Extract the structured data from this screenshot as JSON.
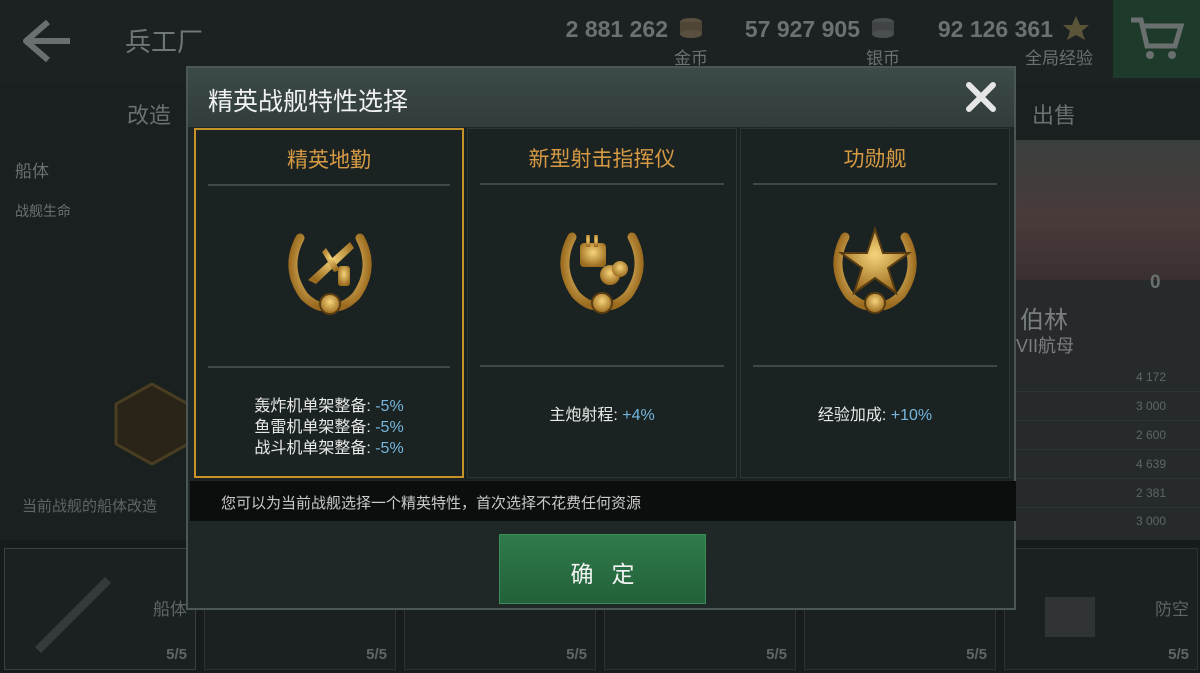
{
  "header": {
    "page_title": "兵工厂",
    "resources": [
      {
        "value": "2 881 262",
        "label": "金币",
        "icon": "gold-coins-icon"
      },
      {
        "value": "57 927 905",
        "label": "银币",
        "icon": "silver-coins-icon"
      },
      {
        "value": "92 126 361",
        "label": "全局经验",
        "icon": "star-icon"
      }
    ]
  },
  "tabs": {
    "left": "改造",
    "right": "出售"
  },
  "left_panel": {
    "title": "船体",
    "subtitle": "战舰生命",
    "note": "当前战舰的船体改造"
  },
  "right_panel": {
    "count": "0",
    "ship_name": "伯林",
    "ship_type": "VII航母",
    "numbers": [
      "4 172",
      "3 000",
      "2 600",
      "4 639",
      "2 381",
      "3 000"
    ]
  },
  "bottom_slots": [
    {
      "name": "船体",
      "count": "5/5"
    },
    {
      "name": "",
      "count": "5/5"
    },
    {
      "name": "",
      "count": "5/5"
    },
    {
      "name": "",
      "count": "5/5"
    },
    {
      "name": "",
      "count": "5/5"
    },
    {
      "name": "防空",
      "count": "5/5"
    }
  ],
  "modal": {
    "title": "精英战舰特性选择",
    "cards": [
      {
        "title": "精英地勤",
        "selected": true,
        "icon": "aircraft-laurel-emblem-icon",
        "stats": [
          {
            "label": "轰炸机单架整备: ",
            "value": "-5%"
          },
          {
            "label": "鱼雷机单架整备: ",
            "value": "-5%"
          },
          {
            "label": "战斗机单架整备: ",
            "value": "-5%"
          }
        ]
      },
      {
        "title": "新型射击指挥仪",
        "selected": false,
        "icon": "gun-turret-laurel-emblem-icon",
        "stats": [
          {
            "label": "主炮射程: ",
            "value": "+4%"
          }
        ]
      },
      {
        "title": "功勋舰",
        "selected": false,
        "icon": "star-laurel-emblem-icon",
        "stats": [
          {
            "label": "经验加成: ",
            "value": "+10%"
          }
        ]
      }
    ],
    "info": "您可以为当前战舰选择一个精英特性，首次选择不花费任何资源",
    "confirm_label": "确定"
  },
  "colors": {
    "accent_gold": "#d69a44",
    "selected_border": "#c8922a",
    "stat_value_blue": "#74b6de",
    "confirm_green": "#2f7a4a"
  }
}
